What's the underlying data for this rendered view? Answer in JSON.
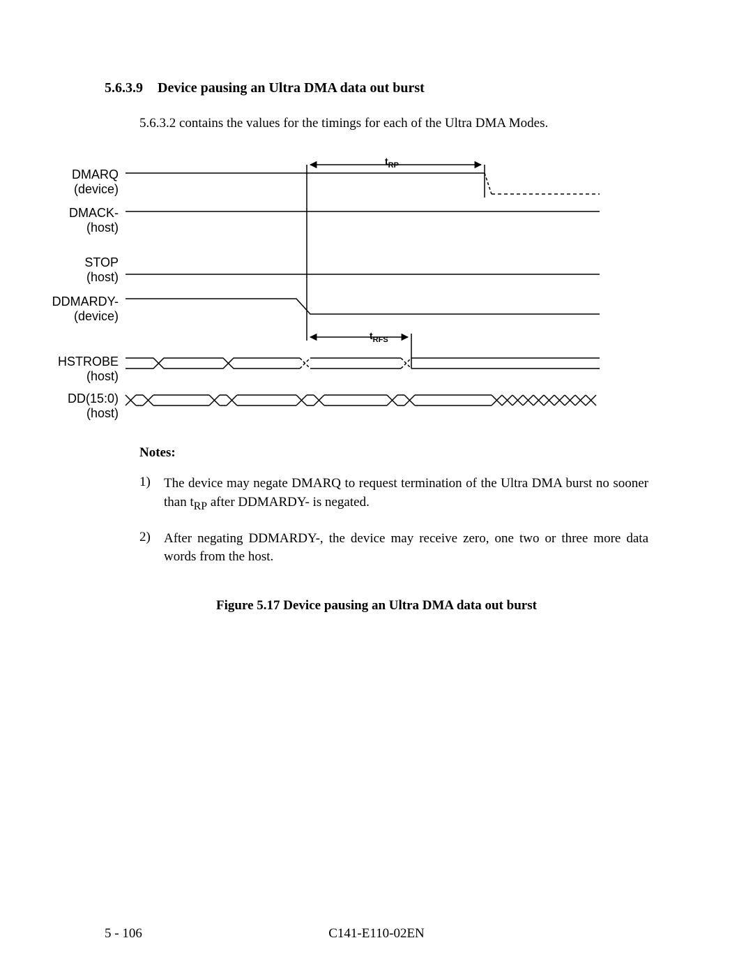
{
  "section": {
    "number": "5.6.3.9",
    "title": "Device pausing an Ultra DMA data out burst",
    "intro": "5.6.3.2 contains the values for the timings for each of the Ultra DMA Modes."
  },
  "diagram": {
    "signals": {
      "dmarq": {
        "name": "DMARQ",
        "src": "(device)"
      },
      "dmack": {
        "name": "DMACK-",
        "src": "(host)"
      },
      "stop": {
        "name": "STOP",
        "src": "(host)"
      },
      "ddmardy": {
        "name": "DDMARDY-",
        "src": "(device)"
      },
      "hstrobe": {
        "name": "HSTROBE",
        "src": "(host)"
      },
      "dd": {
        "name": "DD(15:0)",
        "src": "(host)"
      }
    },
    "timing": {
      "trp": "t<sub>RP</sub>",
      "trfs": "t<sub>RFS</sub>"
    }
  },
  "notes": {
    "heading": "Notes:",
    "items": [
      {
        "marker": "1)",
        "text_html": "The device may negate DMARQ to request termination of the Ultra DMA burst no sooner than t<sub>RP</sub> after DDMARDY- is negated."
      },
      {
        "marker": "2)",
        "text_html": "After negating DDMARDY-, the device may receive zero, one two or three more data words from the host."
      }
    ]
  },
  "figure_caption": "Figure 5.17   Device pausing an Ultra DMA data out burst",
  "footer": {
    "page": "5 - 106",
    "doc_id": "C141-E110-02EN"
  }
}
